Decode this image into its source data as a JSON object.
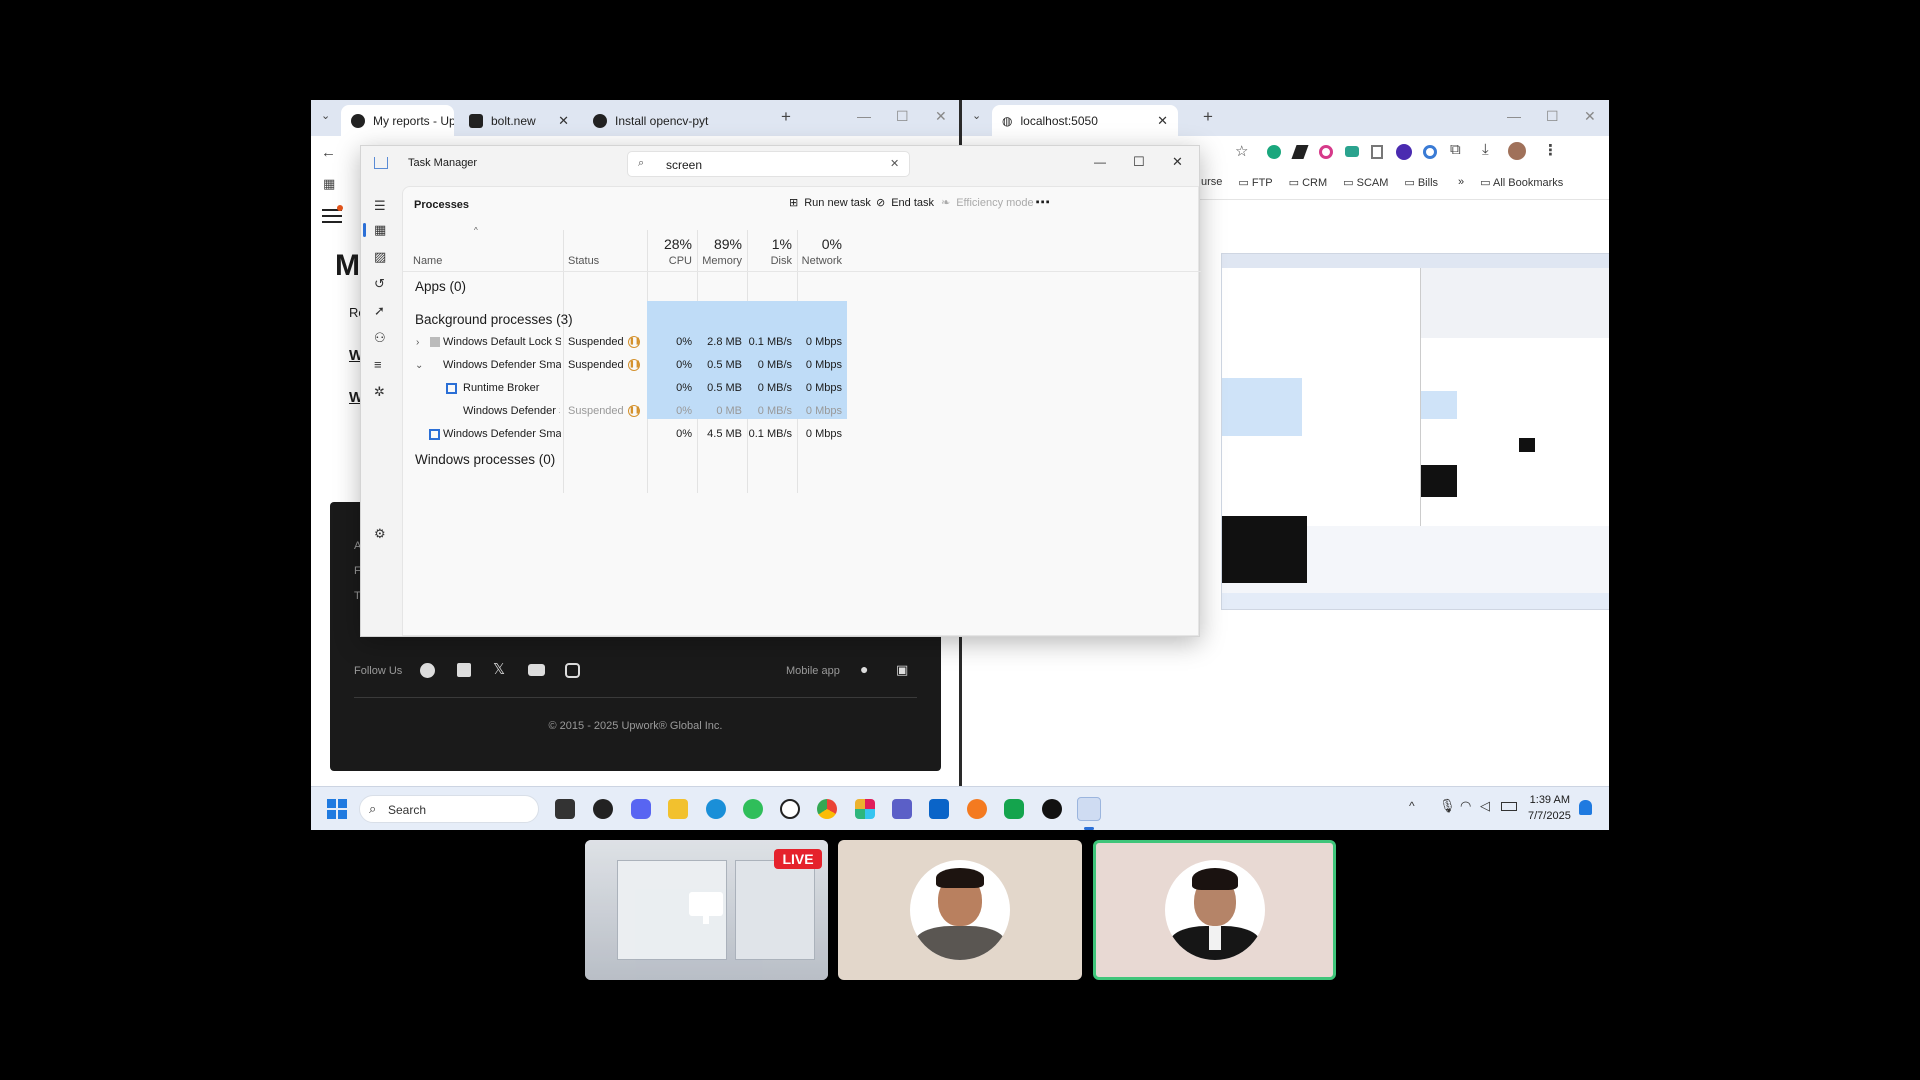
{
  "left_browser": {
    "tabs": [
      {
        "label": "My reports - Upw",
        "active": true
      },
      {
        "label": "bolt.new",
        "active": false
      },
      {
        "label": "Install opencv-pyt",
        "active": false
      }
    ],
    "new_tab": "+",
    "page": {
      "heading_initial": "M",
      "link_1": "Re",
      "link_2": "W",
      "link_3": "W",
      "footer_lines": [
        "A",
        "F",
        "T"
      ],
      "follow_us": "Follow Us",
      "mobile_app": "Mobile app",
      "copyright": "© 2015 - 2025 Upwork® Global Inc."
    }
  },
  "right_browser": {
    "tab_label": "localhost:5050",
    "new_tab": "+",
    "bookmarks": [
      "urse",
      "FTP",
      "CRM",
      "SCAM",
      "Bills"
    ],
    "more_bookmarks": "»",
    "all_bookmarks": "All Bookmarks"
  },
  "task_manager": {
    "title": "Task Manager",
    "search_value": "screen",
    "section": "Processes",
    "run_new_task": "Run new task",
    "end_task": "End task",
    "efficiency_mode": "Efficiency mode",
    "columns": {
      "name": "Name",
      "status": "Status",
      "cpu_pct": "28%",
      "cpu": "CPU",
      "mem_pct": "89%",
      "mem": "Memory",
      "disk_pct": "1%",
      "disk": "Disk",
      "net_pct": "0%",
      "net": "Network"
    },
    "groups": {
      "apps": "Apps (0)",
      "background": "Background processes (3)",
      "windows": "Windows processes (0)"
    },
    "rows": [
      {
        "name": "Windows Default Lock Screen ...",
        "status": "Suspended",
        "cpu": "0%",
        "mem": "2.8 MB",
        "disk": "0.1 MB/s",
        "net": "0 Mbps"
      },
      {
        "name": "Windows Defender SmartScre...",
        "status": "Suspended",
        "cpu": "0%",
        "mem": "0.5 MB",
        "disk": "0 MB/s",
        "net": "0 Mbps"
      },
      {
        "name": "Runtime Broker",
        "status": "",
        "cpu": "0%",
        "mem": "0.5 MB",
        "disk": "0 MB/s",
        "net": "0 Mbps"
      },
      {
        "name": "Windows Defender Smart...",
        "status": "Suspended",
        "cpu": "0%",
        "mem": "0 MB",
        "disk": "0 MB/s",
        "net": "0 Mbps"
      },
      {
        "name": "Windows Defender SmartScre...",
        "status": "",
        "cpu": "0%",
        "mem": "4.5 MB",
        "disk": "0.1 MB/s",
        "net": "0 Mbps"
      }
    ]
  },
  "taskbar": {
    "search_placeholder": "Search",
    "time": "1:39 AM",
    "date": "7/7/2025"
  },
  "call": {
    "live_badge": "LIVE"
  },
  "colors": {
    "highlight": "#bfdcf7",
    "suspended_icon": "#d4912c",
    "live_red": "#e5222c",
    "active_tile_border": "#3fc57a"
  }
}
